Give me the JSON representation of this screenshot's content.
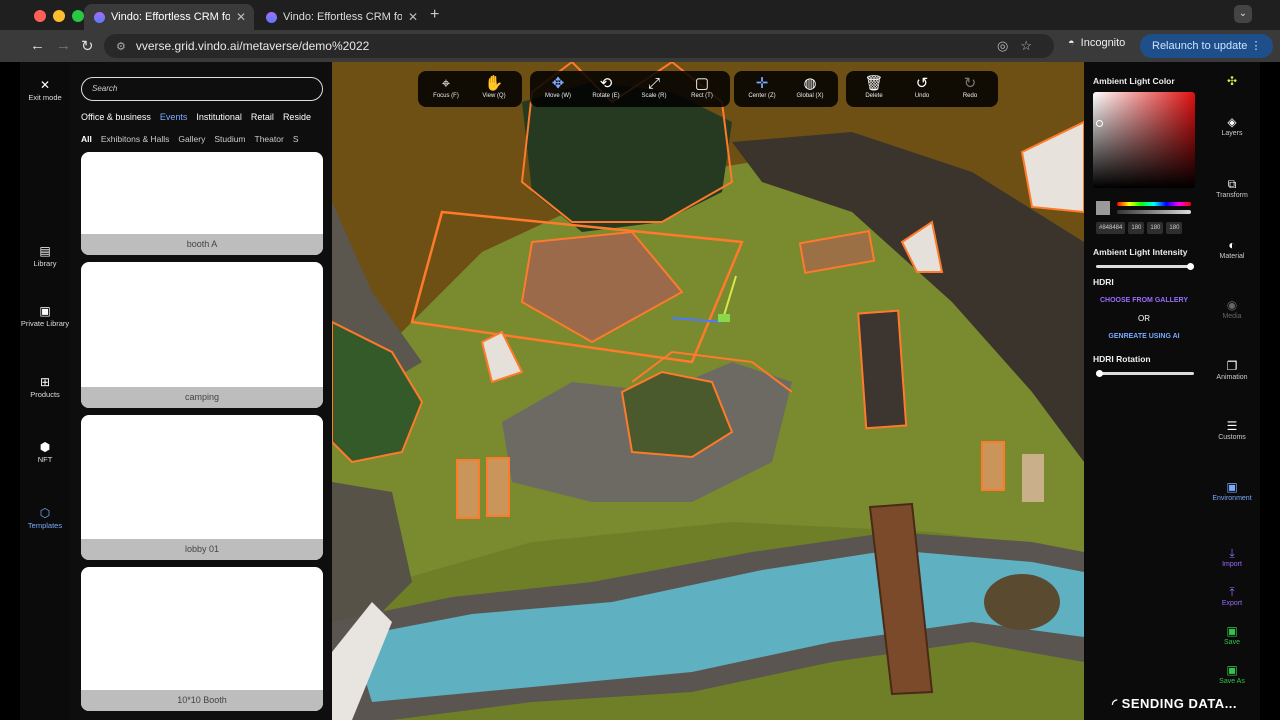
{
  "browser": {
    "tabs": [
      {
        "title": "Vindo: Effortless CRM for Enc"
      },
      {
        "title": "Vindo: Effortless CRM for Enc"
      }
    ],
    "url": "vverse.grid.vindo.ai/metaverse/demo%2022",
    "incognito_label": "Incognito",
    "relaunch_label": "Relaunch to update"
  },
  "left_rail": {
    "exit": "Exit mode",
    "library": "Library",
    "private_library": "Private Library",
    "products": "Products",
    "nft": "NFT",
    "templates": "Templates"
  },
  "library_panel": {
    "search_placeholder": "Search",
    "categories": [
      "Office & business",
      "Events",
      "Institutional",
      "Retail",
      "Reside"
    ],
    "selected_category": "Events",
    "subcategories": [
      "All",
      "Exhibitons & Halls",
      "Gallery",
      "Studium",
      "Theator",
      "S"
    ],
    "selected_subcategory": "All",
    "cards": [
      "booth A",
      "camping",
      "lobby 01",
      "10*10 Booth"
    ]
  },
  "toolbar": {
    "focus": "Focus (F)",
    "view": "View (Q)",
    "move": "Move (W)",
    "rotate": "Rotate (E)",
    "scale": "Scale (R)",
    "rect": "Rect (T)",
    "center": "Center (Z)",
    "global": "Global (X)",
    "delete": "Delete",
    "undo": "Undo",
    "redo": "Redo"
  },
  "properties": {
    "ambient_color_label": "Ambient Light Color",
    "hex_value": "#848484",
    "rgb": [
      "180",
      "180",
      "180"
    ],
    "ambient_intensity_label": "Ambient Light Intensity",
    "hdri_label": "HDRI",
    "choose_gallery": "CHOOSE FROM GALLERY",
    "or": "OR",
    "generate_ai": "GENREATE USING AI",
    "hdri_rotation_label": "HDRI Rotation",
    "intensity_value": 1.0,
    "rotation_value": 0.0
  },
  "right_rail": {
    "layers": "Layers",
    "transform": "Transform",
    "material": "Material",
    "media": "Media",
    "animation": "Animation",
    "customs": "Customs",
    "environment": "Environment",
    "import": "Import",
    "export": "Export",
    "save": "Save",
    "save_as": "Save As"
  },
  "status": {
    "sending": "SENDING DATA..."
  },
  "colors": {
    "accent_blue": "#7aa9ff",
    "accent_violet": "#9c6bff",
    "selection_orange": "#ff7a2a",
    "save_green": "#35c24a"
  }
}
